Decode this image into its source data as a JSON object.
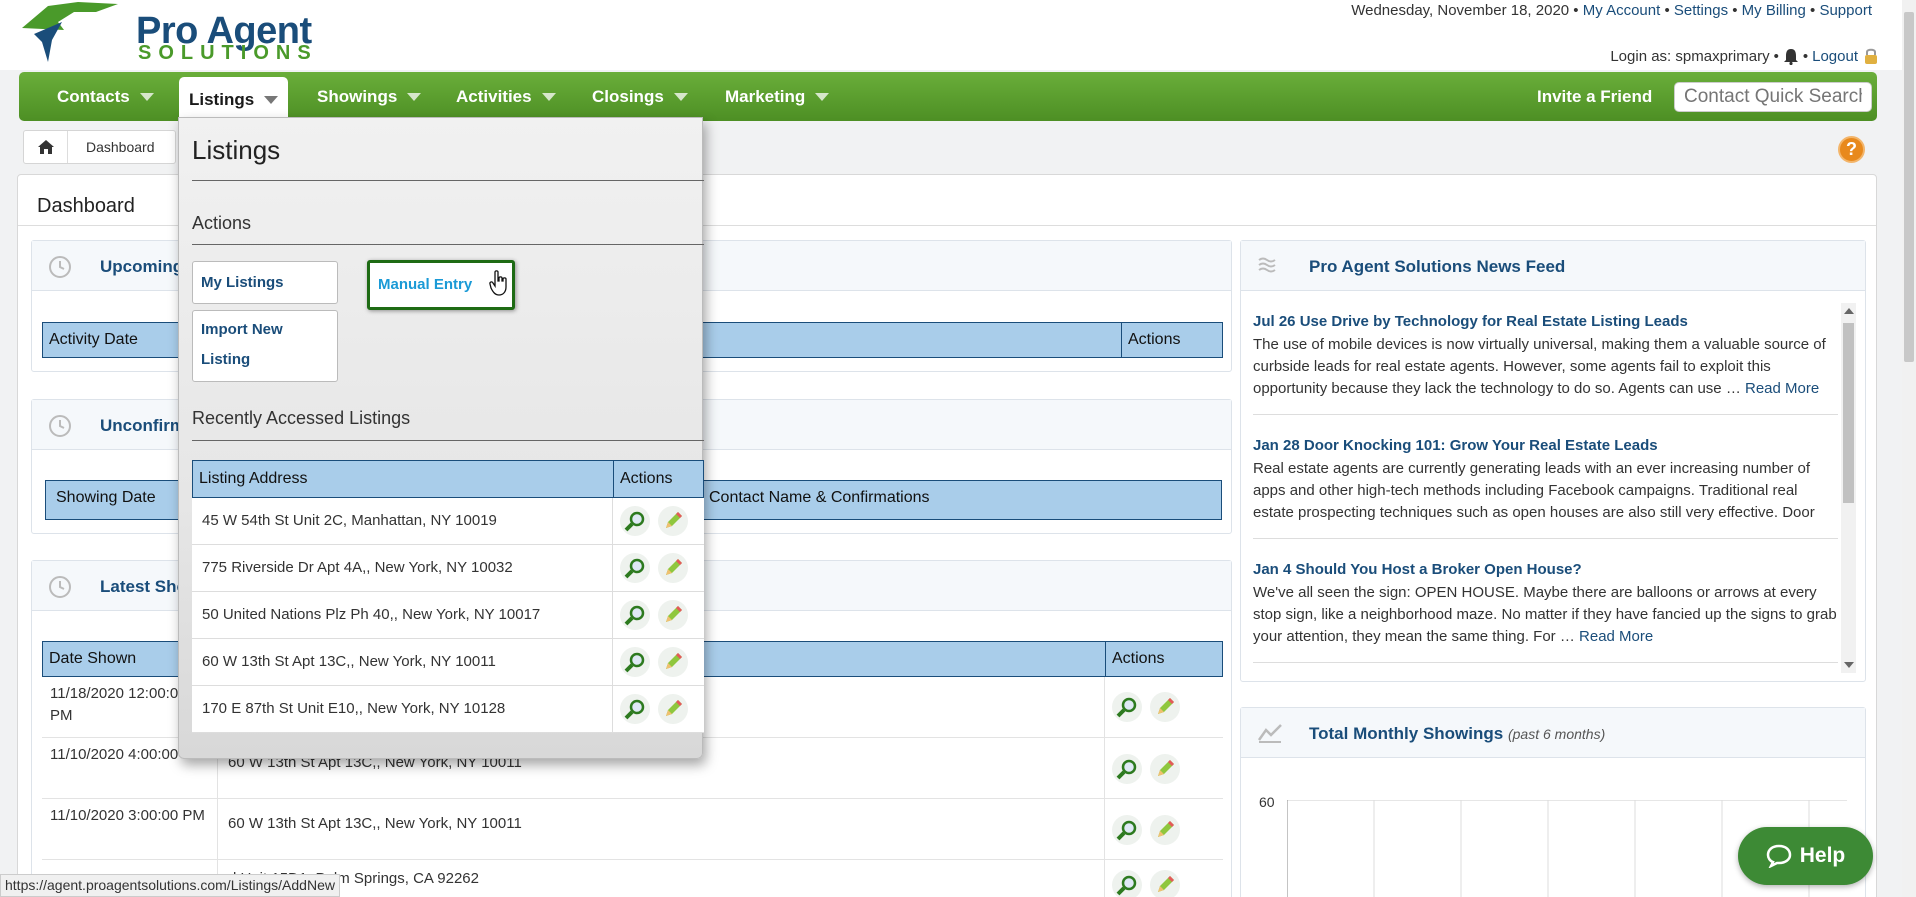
{
  "header": {
    "logo_line1": "Pro Agent",
    "logo_line2": "SOLUTIONS",
    "date": "Wednesday, November 18, 2020",
    "links": [
      "My Account",
      "Settings",
      "My Billing",
      "Support"
    ],
    "login_label": "Login as: spmaxprimary",
    "logout": "Logout"
  },
  "nav": {
    "items": [
      "Contacts",
      "Listings",
      "Showings",
      "Activities",
      "Closings",
      "Marketing"
    ],
    "active": "Listings",
    "invite": "Invite a Friend",
    "search_placeholder": "Contact Quick Search"
  },
  "breadcrumb": {
    "item": "Dashboard"
  },
  "dashboard": {
    "title": "Dashboard",
    "upcoming": {
      "title": "Upcoming",
      "cols": [
        "Activity Date",
        "Actions"
      ]
    },
    "unconfirmed": {
      "title": "Unconfirm",
      "cols": [
        "Showing Date",
        "Contact Name & Confirmations"
      ]
    },
    "latest": {
      "title": "Latest Sho",
      "cols": [
        "Date Shown",
        "Actions"
      ],
      "rows": [
        {
          "date": "11/18/2020 12:00:00 PM",
          "addr": ""
        },
        {
          "date": "11/10/2020 4:00:00 PM",
          "addr": "60 W 13th St Apt 13C,, New York, NY 10011"
        },
        {
          "date": "11/10/2020 3:00:00 PM",
          "addr": "60 W 13th St Apt 13C,, New York, NY 10011"
        },
        {
          "date": "",
          "addr": "d Unit 15D1, Palm Springs, CA 92262"
        }
      ]
    },
    "news": {
      "title": "Pro Agent Solutions News Feed",
      "items": [
        {
          "title": "Jul 26 Use Drive by Technology for Real Estate Listing Leads",
          "text": "The use of mobile devices is now virtually universal, making them a valuable source of curbside leads for real estate agents. However, some agents fail to exploit this opportunity because they lack the technology to do so. Agents can use …",
          "more": "Read More"
        },
        {
          "title": "Jan 28 Door Knocking 101: Grow Your Real Estate Leads",
          "text": "Real estate agents are currently generating leads with an ever increasing number of apps and other high-tech methods including Facebook campaigns. Traditional real estate prospecting techniques such as open houses are also still very effective. Door",
          "more": ""
        },
        {
          "title": "Jan 4 Should You Host a Broker Open House?",
          "text": "We've all seen the sign: OPEN HOUSE. Maybe there are balloons or arrows at every stop sign, like a neighborhood maze. No matter if they have fancied up the signs to grab your attention, they mean the same thing. For …",
          "more": "Read More"
        }
      ]
    },
    "showings_chart": {
      "title": "Total Monthly Showings",
      "subtitle": "(past 6 months)",
      "ytick": "60"
    }
  },
  "dropdown": {
    "title": "Listings",
    "actions_label": "Actions",
    "my_listings": "My Listings",
    "import_listing": "Import New Listing",
    "manual_entry": "Manual Entry",
    "recent_label": "Recently Accessed Listings",
    "cols": [
      "Listing Address",
      "Actions"
    ],
    "rows": [
      "45 W 54th St Unit 2C, Manhattan, NY 10019",
      "775 Riverside Dr Apt 4A,, New York, NY 10032",
      "50 United Nations Plz Ph 40,, New York, NY 10017",
      "60 W 13th St Apt 13C,, New York, NY 10011",
      "170 E 87th St Unit E10,, New York, NY 10128"
    ]
  },
  "status_url": "https://agent.proagentsolutions.com/Listings/AddNew",
  "help_label": "Help",
  "colors": {
    "brand_green": "#5a9e2f",
    "brand_blue": "#1a4d7a",
    "header_blue": "#a9cdea"
  }
}
